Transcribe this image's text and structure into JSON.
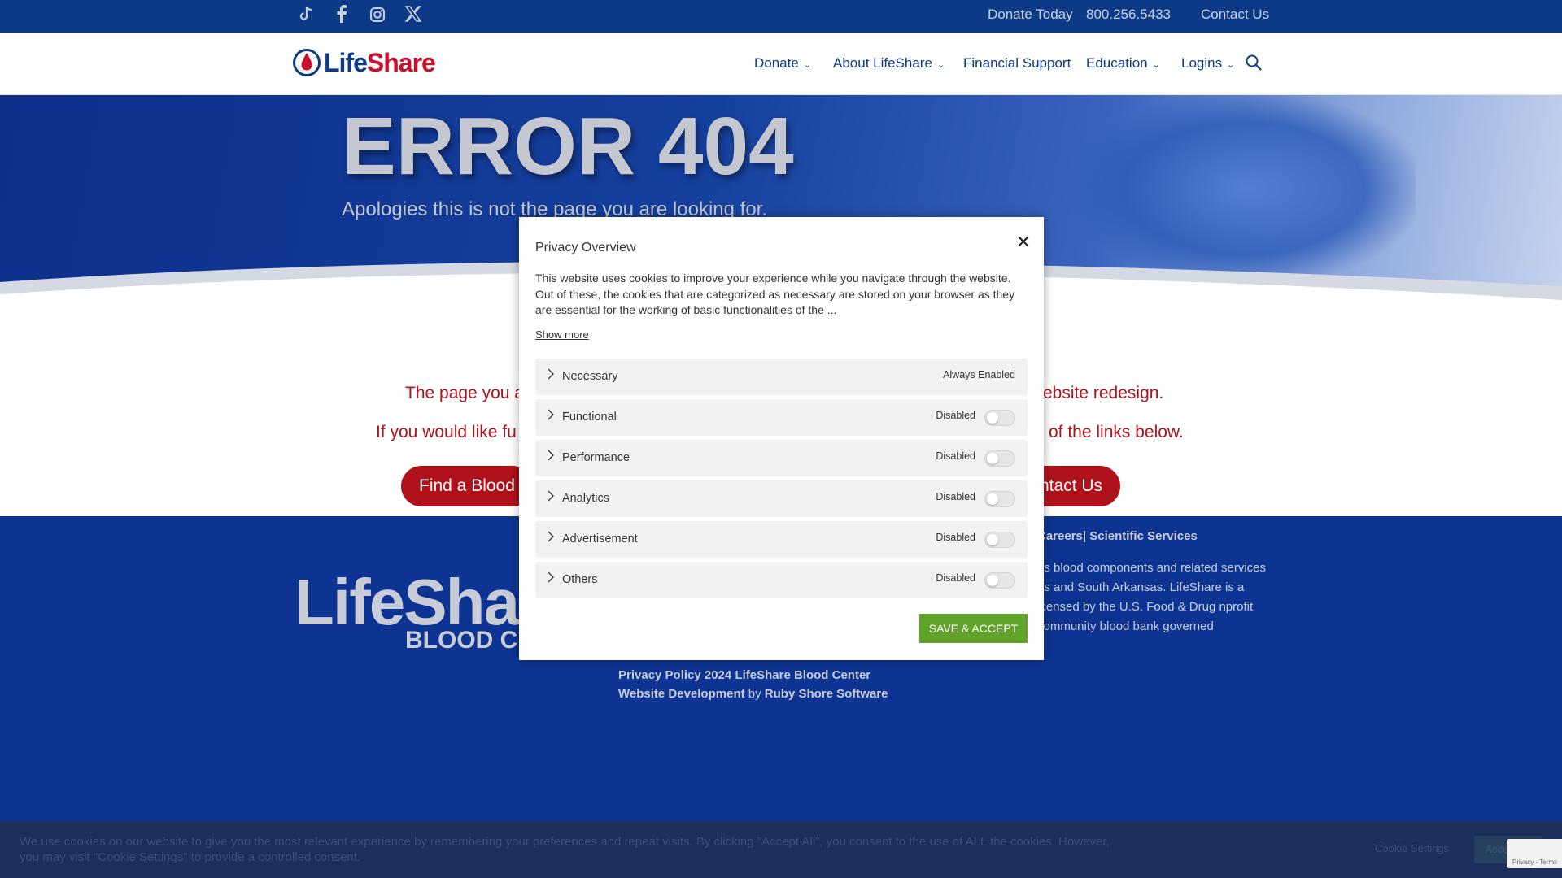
{
  "topbar": {
    "social": [
      "tiktok-icon",
      "facebook-icon",
      "instagram-icon",
      "x-twitter-icon"
    ],
    "donate_today": "Donate Today",
    "phone": "800.256.5433",
    "contact": "Contact Us"
  },
  "header": {
    "logo_life": "Life",
    "logo_share": "Share",
    "nav": [
      {
        "label": "Donate",
        "has_dropdown": true
      },
      {
        "label": "About LifeShare",
        "has_dropdown": true
      },
      {
        "label": "Financial Support",
        "has_dropdown": false
      },
      {
        "label": "Education",
        "has_dropdown": true
      },
      {
        "label": "Logins",
        "has_dropdown": true
      }
    ],
    "chevron": "⌄",
    "search_icon": "search-icon"
  },
  "hero": {
    "title": "ERROR 404",
    "subtitle": "Apologies this is not the page you are looking for."
  },
  "content": {
    "line1_left": "The page you a",
    "line1_right": "ebsite redesign.",
    "line2_left": "If you would like fu",
    "line2_right": "of the links below.",
    "button_find": "Find a Blood",
    "button_contact": "ntact Us"
  },
  "footer": {
    "logo_main": "LifeSha",
    "logo_sub": "BLOOD CE",
    "links": "Careers| Scientific Services",
    "paragraph": "es blood components and related services as and South Arkansas. LifeShare is a icensed by the U.S. Food & Drug nprofit community blood bank governed",
    "credit1": "Privacy Policy 2024 LifeShare Blood Center",
    "credit2_bold1": "Website Development",
    "credit2_by": " by ",
    "credit2_bold2": "Ruby Shore Software"
  },
  "cookie_bar": {
    "text": "We use cookies on our website to give you the most relevant experience by remembering your preferences and repeat visits. By clicking \"Accept All\", you consent to the use of ALL the cookies. However, you may visit \"Cookie Settings\" to provide a controlled consent.",
    "settings": "Cookie Settings",
    "accept": "Accept All"
  },
  "recaptcha": {
    "text": "Privacy - Terms"
  },
  "modal": {
    "title": "Privacy Overview",
    "close": "✕",
    "description": "This website uses cookies to improve your experience while you navigate through the website. Out of these, the cookies that are categorized as necessary are stored on your browser as they are essential for the working of basic functionalities of the ...",
    "show_more": "Show more",
    "categories": [
      {
        "label": "Necessary",
        "status": "Always Enabled",
        "toggle": false
      },
      {
        "label": "Functional",
        "status": "Disabled",
        "toggle": true
      },
      {
        "label": "Performance",
        "status": "Disabled",
        "toggle": true
      },
      {
        "label": "Analytics",
        "status": "Disabled",
        "toggle": true
      },
      {
        "label": "Advertisement",
        "status": "Disabled",
        "toggle": true
      },
      {
        "label": "Others",
        "status": "Disabled",
        "toggle": true
      }
    ],
    "save_label": "SAVE & ACCEPT"
  },
  "colors": {
    "navy": "#0e3493",
    "red": "#b0121b",
    "green": "#61a229"
  }
}
